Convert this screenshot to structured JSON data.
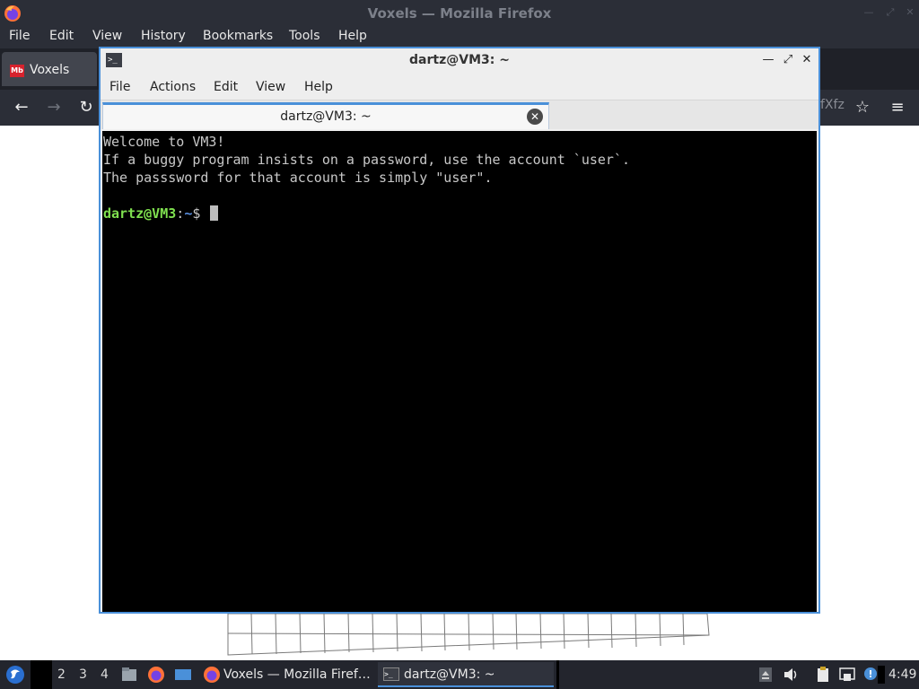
{
  "firefox": {
    "window_title": "Voxels — Mozilla Firefox",
    "menu": [
      "File",
      "Edit",
      "View",
      "History",
      "Bookmarks",
      "Tools",
      "Help"
    ],
    "tab": {
      "label": "Voxels",
      "favicon_text": "Mb"
    },
    "url_fragment": "fXfz"
  },
  "terminal": {
    "window_title": "dartz@VM3: ~",
    "menu": [
      "File",
      "Actions",
      "Edit",
      "View",
      "Help"
    ],
    "tab_label": "dartz@VM3: ~",
    "lines": [
      "Welcome to VM3!",
      "If a buggy program insists on a password, use the account `user`.",
      "The passsword for that account is simply \"user\"."
    ],
    "prompt": {
      "user_host": "dartz@VM3",
      "sep": ":",
      "path": "~",
      "symbol": "$"
    }
  },
  "taskbar": {
    "workspaces": [
      "2",
      "3",
      "4"
    ],
    "tasks": [
      {
        "label": "Voxels — Mozilla Firef…",
        "icon": "firefox-icon",
        "active": false
      },
      {
        "label": "dartz@VM3: ~",
        "icon": "terminal-icon",
        "active": true
      }
    ],
    "clock": "4:49"
  },
  "colors": {
    "accent": "#4a90d9",
    "prompt_user": "#7fe04f",
    "prompt_path": "#5a8fe0"
  }
}
